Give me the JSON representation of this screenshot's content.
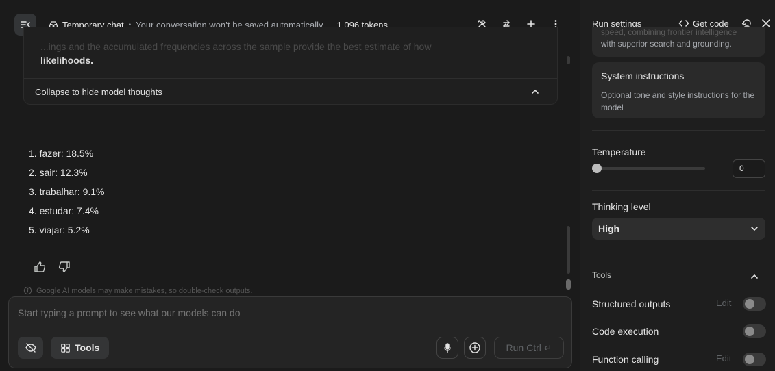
{
  "topbar": {
    "temporary_chat": "Temporary chat",
    "separator": "•",
    "notice": "Your conversation won’t be saved automatically",
    "tokens": "1.096 tokens"
  },
  "thoughts": {
    "faded_text": "...ings and the accumulated frequencies across the sample provide the best estimate of how",
    "last_line": "likelihoods.",
    "collapse_label": "Collapse to hide model thoughts"
  },
  "answer": {
    "items": [
      "1. fazer: 18.5%",
      "2. sair: 12.3%",
      "3. trabalhar: 9.1%",
      "4. estudar: 7.4%",
      "5. viajar: 5.2%"
    ]
  },
  "disclaimer": "Google AI models may make mistakes, so double-check outputs.",
  "prompt": {
    "placeholder": "Start typing a prompt to see what our models can do",
    "tools_label": "Tools",
    "run_label": "Run",
    "run_shortcut": "Ctrl ↵"
  },
  "settings": {
    "title": "Run settings",
    "get_code": "Get code",
    "model_desc_cut": "speed, combining frontier intelligence",
    "model_desc": "with superior search and grounding.",
    "system_title": "System instructions",
    "system_placeholder": "Optional tone and style instructions for the model",
    "temperature_label": "Temperature",
    "temperature_value": "0",
    "temperature_fraction": 0,
    "thinking_label": "Thinking level",
    "thinking_value": "High",
    "tools_heading": "Tools",
    "tools": [
      {
        "label": "Structured outputs",
        "edit": "Edit"
      },
      {
        "label": "Code execution",
        "edit": ""
      },
      {
        "label": "Function calling",
        "edit": "Edit"
      }
    ]
  }
}
